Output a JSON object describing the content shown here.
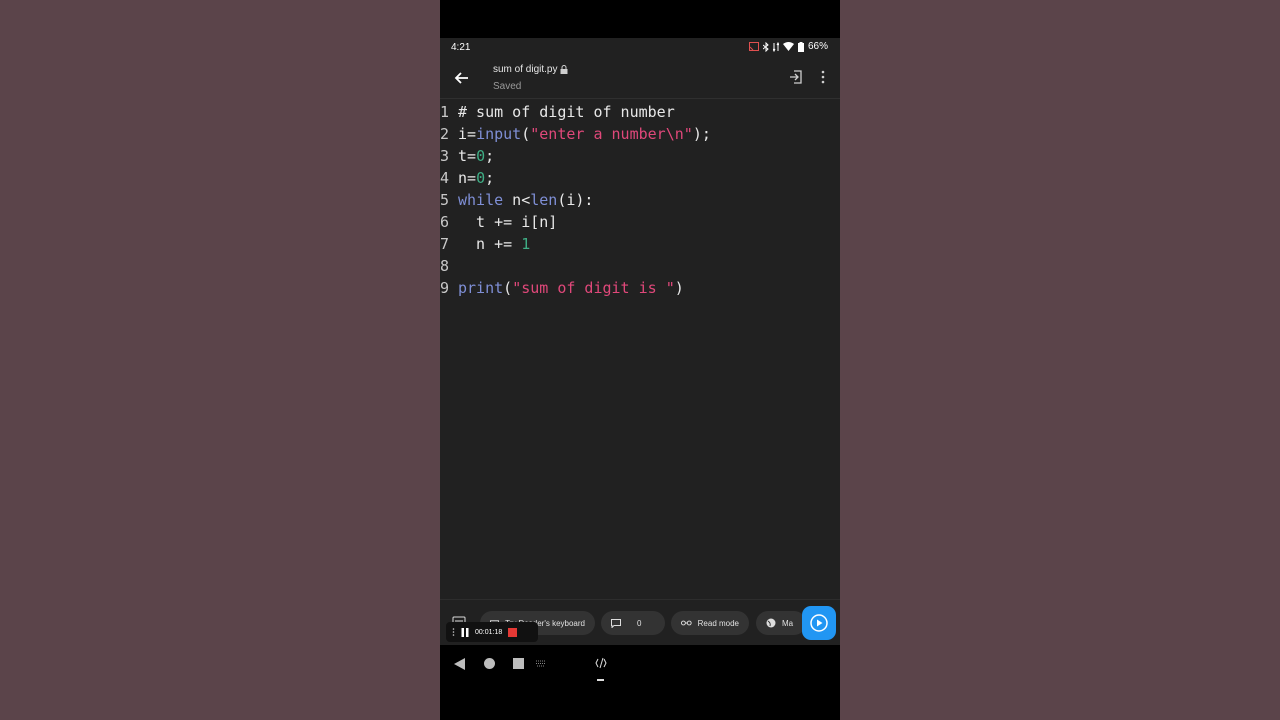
{
  "status_bar": {
    "time": "4:21",
    "battery": "66%"
  },
  "app_bar": {
    "file_name": "sum of digit.py",
    "save_status": "Saved"
  },
  "editor": {
    "lines": [
      {
        "number": "1",
        "tokens": [
          {
            "t": "# sum of digit of number",
            "c": "plain"
          }
        ]
      },
      {
        "number": "2",
        "tokens": [
          {
            "t": "i=",
            "c": "plain"
          },
          {
            "t": "input",
            "c": "kw"
          },
          {
            "t": "(",
            "c": "plain"
          },
          {
            "t": "\"enter a number\\n\"",
            "c": "str"
          },
          {
            "t": ");",
            "c": "plain"
          }
        ]
      },
      {
        "number": "3",
        "tokens": [
          {
            "t": "t=",
            "c": "plain"
          },
          {
            "t": "0",
            "c": "num"
          },
          {
            "t": ";",
            "c": "plain"
          }
        ]
      },
      {
        "number": "4",
        "tokens": [
          {
            "t": "n=",
            "c": "plain"
          },
          {
            "t": "0",
            "c": "num"
          },
          {
            "t": ";",
            "c": "plain"
          }
        ]
      },
      {
        "number": "5",
        "tokens": [
          {
            "t": "while",
            "c": "kw"
          },
          {
            "t": " n<",
            "c": "plain"
          },
          {
            "t": "len",
            "c": "kw"
          },
          {
            "t": "(i):",
            "c": "plain"
          }
        ]
      },
      {
        "number": "6",
        "tokens": [
          {
            "t": "  t += i[n]",
            "c": "plain"
          }
        ]
      },
      {
        "number": "7",
        "tokens": [
          {
            "t": "  n += ",
            "c": "plain"
          },
          {
            "t": "1",
            "c": "num"
          }
        ]
      },
      {
        "number": "8",
        "tokens": []
      },
      {
        "number": "9",
        "tokens": [
          {
            "t": "print",
            "c": "kw"
          },
          {
            "t": "(",
            "c": "plain"
          },
          {
            "t": "\"sum of digit is \"",
            "c": "str"
          },
          {
            "t": ")",
            "c": "plain"
          }
        ]
      }
    ]
  },
  "bottom_bar": {
    "keyboard_chip": "Try Dcoder's keyboard",
    "comments_count": "0",
    "read_mode": "Read mode",
    "language_chip": "Ma"
  },
  "recorder": {
    "elapsed": "00:01:18"
  },
  "colors": {
    "accent": "#2196f3",
    "keyword": "#7f8fd6",
    "string": "#e0487a",
    "number": "#3fae85"
  }
}
